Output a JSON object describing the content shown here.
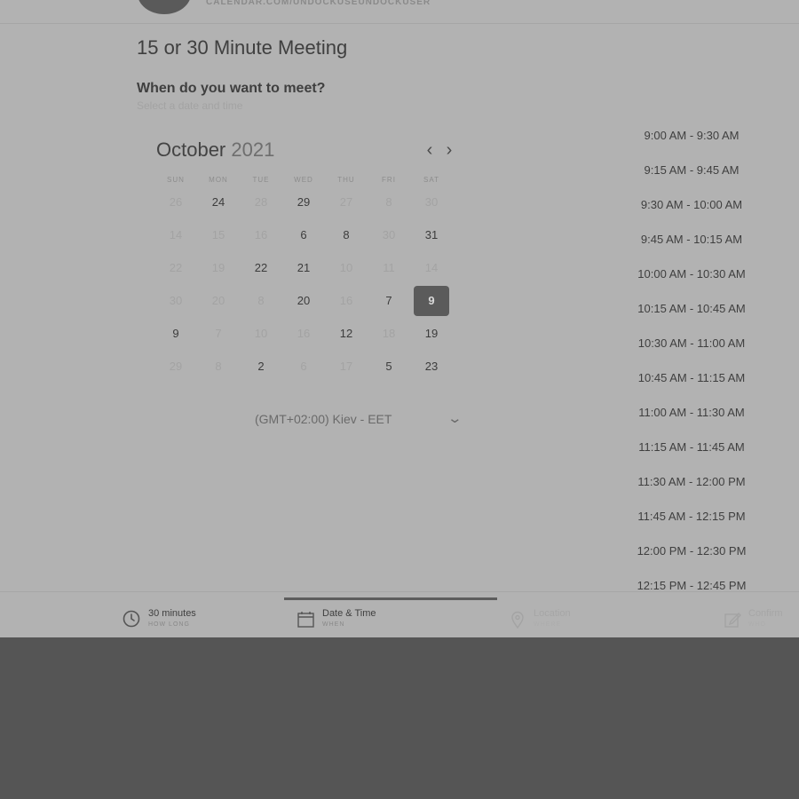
{
  "header": {
    "url": "CALENDAR.COM/UNDOCKUSEUNDOCKUSER",
    "title": "15 or 30 Minute Meeting"
  },
  "question": {
    "heading": "When do you want to meet?",
    "hint": "Select a date and time"
  },
  "calendar": {
    "month": "October",
    "year": "2021",
    "prev_icon": "chevron-left-icon",
    "next_icon": "chevron-right-icon",
    "weekdays": [
      "SUN",
      "MON",
      "TUE",
      "WED",
      "THU",
      "FRI",
      "SAT"
    ],
    "rows": [
      [
        "26",
        "24",
        "28",
        "29",
        "27",
        "8",
        "30"
      ],
      [
        "14",
        "15",
        "16",
        "6",
        "8",
        "30",
        "31"
      ],
      [
        "22",
        "19",
        "22",
        "21",
        "10",
        "11",
        "14"
      ],
      [
        "30",
        "20",
        "8",
        "20",
        "16",
        "7",
        "9"
      ],
      [
        "9",
        "7",
        "10",
        "16",
        "12",
        "18",
        "19"
      ],
      [
        "29",
        "8",
        "2",
        "6",
        "17",
        "5",
        "23"
      ]
    ],
    "selected_day": "9",
    "timezone": "(GMT+02:00) Kiev - EET",
    "timezone_icon": "chevron-down-icon"
  },
  "time_slots": [
    "9:00 AM - 9:30 AM",
    "9:15 AM - 9:45 AM",
    "9:30 AM - 10:00 AM",
    "9:45 AM - 10:15 AM",
    "10:00 AM - 10:30 AM",
    "10:15 AM - 10:45 AM",
    "10:30 AM - 11:00 AM",
    "10:45 AM - 11:15 AM",
    "11:00 AM - 11:30 AM",
    "11:15 AM - 11:45 AM",
    "11:30 AM - 12:00 PM",
    "11:45 AM - 12:15 PM",
    "12:00 PM - 12:30 PM",
    "12:15 PM - 12:45 PM"
  ],
  "steps": [
    {
      "label": "30 minutes",
      "sub": "HOW LONG",
      "icon": "clock-icon"
    },
    {
      "label": "Date & Time",
      "sub": "WHEN",
      "icon": "calendar-icon"
    },
    {
      "label": "Location",
      "sub": "WHERE",
      "icon": "location-pin-icon"
    },
    {
      "label": "Confirm",
      "sub": "WHO",
      "icon": "edit-icon"
    }
  ]
}
